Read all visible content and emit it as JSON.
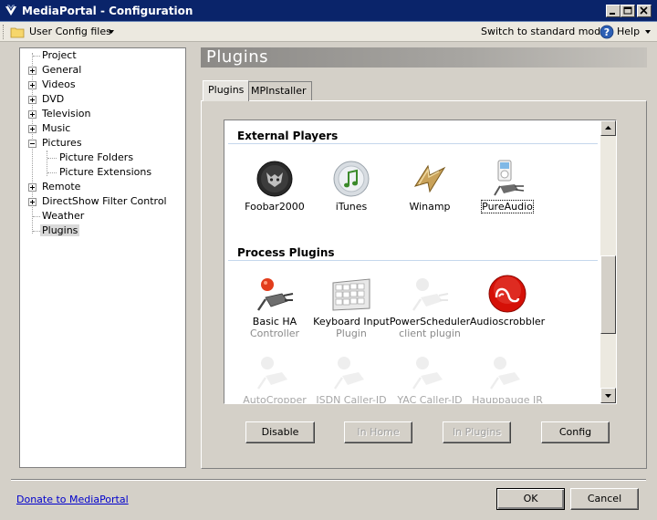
{
  "window": {
    "title": "MediaPortal - Configuration"
  },
  "menubar": {
    "user_config": "User Config files",
    "switch_mode": "Switch to standard mode",
    "help": "Help"
  },
  "tree": {
    "items": [
      {
        "label": "Project"
      },
      {
        "label": "General"
      },
      {
        "label": "Videos"
      },
      {
        "label": "DVD"
      },
      {
        "label": "Television"
      },
      {
        "label": "Music"
      },
      {
        "label": "Pictures"
      },
      {
        "label": "Picture Folders"
      },
      {
        "label": "Picture Extensions"
      },
      {
        "label": "Remote"
      },
      {
        "label": "DirectShow Filter Control"
      },
      {
        "label": "Weather"
      },
      {
        "label": "Plugins"
      }
    ]
  },
  "header": {
    "title": "Plugins"
  },
  "tabs": [
    {
      "label": "Plugins"
    },
    {
      "label": "MPInstaller"
    }
  ],
  "groups": {
    "external": {
      "title": "External Players",
      "plugins": [
        {
          "name": "Foobar2000",
          "icon": "foobar-icon"
        },
        {
          "name": "iTunes",
          "icon": "itunes-icon"
        },
        {
          "name": "Winamp",
          "icon": "winamp-icon"
        },
        {
          "name": "PureAudio",
          "icon": "pureaudio-icon"
        }
      ]
    },
    "process": {
      "title": "Process Plugins",
      "plugins": [
        {
          "name": "Basic HA",
          "name2": "Controller",
          "icon": "plug-icon"
        },
        {
          "name": "Keyboard Input",
          "name2": "Plugin",
          "icon": "keyboard-icon"
        },
        {
          "name": "PowerScheduler",
          "name2": "client plugin",
          "icon": "plug-icon"
        },
        {
          "name": "Audioscrobbler",
          "icon": "lastfm-icon"
        },
        {
          "name": "AutoCropper",
          "icon": "plug-icon"
        },
        {
          "name": "ISDN Caller-ID",
          "icon": "plug-icon"
        },
        {
          "name": "YAC Caller-ID",
          "icon": "plug-icon"
        },
        {
          "name": "Hauppauge IR",
          "icon": "plug-icon"
        }
      ]
    }
  },
  "actions": {
    "disable": "Disable",
    "in_home": "In Home",
    "in_plugins": "In Plugins",
    "config": "Config"
  },
  "footer": {
    "donate": "Donate to MediaPortal",
    "ok": "OK",
    "cancel": "Cancel"
  },
  "colors": {
    "title_bar": "#0a246a",
    "link": "#0000cc",
    "audioscrobbler": "#d51007"
  }
}
